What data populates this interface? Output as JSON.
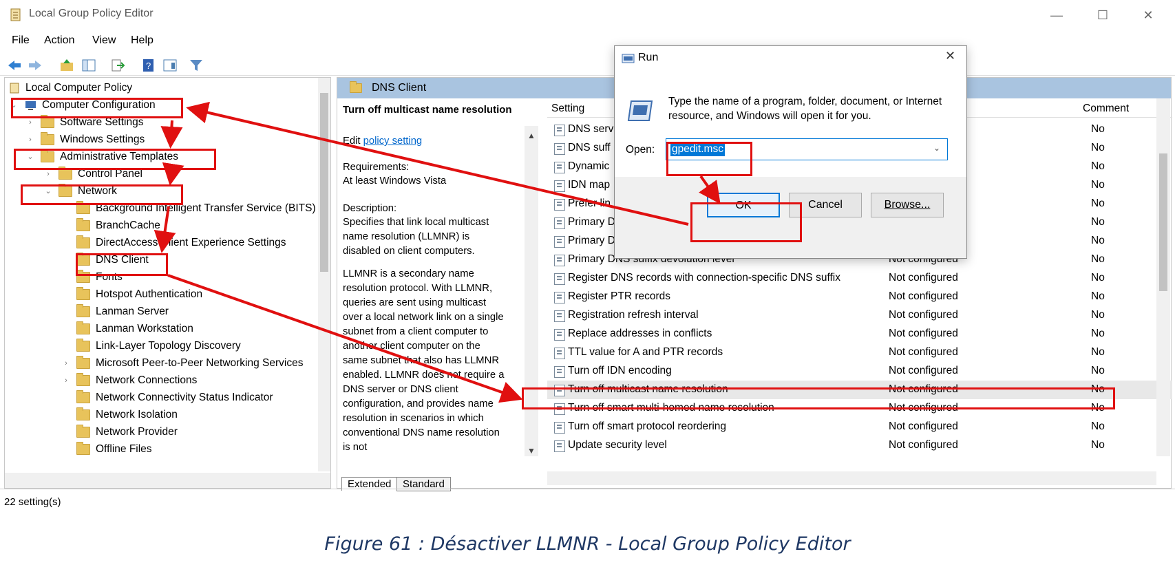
{
  "window": {
    "title": "Local Group Policy Editor",
    "controls": {
      "minimize": "—",
      "maximize": "☐",
      "close": "✕"
    }
  },
  "menu": [
    "File",
    "Action",
    "View",
    "Help"
  ],
  "tree": {
    "items": [
      {
        "label": "Local Computer Policy"
      },
      {
        "label": "Computer Configuration"
      },
      {
        "label": "Software Settings"
      },
      {
        "label": "Windows Settings"
      },
      {
        "label": "Administrative Templates"
      },
      {
        "label": "Control Panel"
      },
      {
        "label": "Network"
      },
      {
        "label": "Background Intelligent Transfer Service (BITS)"
      },
      {
        "label": "BranchCache"
      },
      {
        "label": "DirectAccess Client Experience Settings"
      },
      {
        "label": "DNS Client"
      },
      {
        "label": "Fonts"
      },
      {
        "label": "Hotspot Authentication"
      },
      {
        "label": "Lanman Server"
      },
      {
        "label": "Lanman Workstation"
      },
      {
        "label": "Link-Layer Topology Discovery"
      },
      {
        "label": "Microsoft Peer-to-Peer Networking Services"
      },
      {
        "label": "Network Connections"
      },
      {
        "label": "Network Connectivity Status Indicator"
      },
      {
        "label": "Network Isolation"
      },
      {
        "label": "Network Provider"
      },
      {
        "label": "Offline Files"
      }
    ]
  },
  "details": {
    "folder_title": "DNS Client",
    "policy_title": "Turn off multicast name resolution",
    "edit_link_prefix": "Edit",
    "edit_link": "policy setting",
    "requirements_label": "Requirements:",
    "requirements_value": "At least Windows Vista",
    "description_label": "Description:",
    "description_1": "Specifies that link local multicast name resolution (LLMNR) is disabled on client computers.",
    "description_2": "LLMNR is a secondary name resolution protocol. With LLMNR, queries are sent using multicast over a local network link on a single subnet from a client computer to another client computer on the same subnet that also has LLMNR enabled. LLMNR does not require a DNS server or DNS client configuration, and provides name resolution in scenarios in which conventional DNS name resolution is not",
    "tabs": [
      "Extended",
      "Standard"
    ]
  },
  "list": {
    "headers": {
      "setting": "Setting",
      "comment": "Comment"
    },
    "rows": [
      {
        "name": "DNS serv",
        "state": "",
        "comment": "No"
      },
      {
        "name": "DNS suff",
        "state": "",
        "comment": "No"
      },
      {
        "name": "Dynamic",
        "state": "",
        "comment": "No"
      },
      {
        "name": "IDN map",
        "state": "",
        "comment": "No"
      },
      {
        "name": "Prefer lin",
        "state": "",
        "comment": "No"
      },
      {
        "name": "Primary D",
        "state": "",
        "comment": "No"
      },
      {
        "name": "Primary D",
        "state": "",
        "comment": "No"
      },
      {
        "name": "Primary DNS suffix devolution level",
        "state": "Not configured",
        "comment": "No"
      },
      {
        "name": "Register DNS records with connection-specific DNS suffix",
        "state": "Not configured",
        "comment": "No"
      },
      {
        "name": "Register PTR records",
        "state": "Not configured",
        "comment": "No"
      },
      {
        "name": "Registration refresh interval",
        "state": "Not configured",
        "comment": "No"
      },
      {
        "name": "Replace addresses in conflicts",
        "state": "Not configured",
        "comment": "No"
      },
      {
        "name": "TTL value for A and PTR records",
        "state": "Not configured",
        "comment": "No"
      },
      {
        "name": "Turn off IDN encoding",
        "state": "Not configured",
        "comment": "No"
      },
      {
        "name": "Turn off multicast name resolution",
        "state": "Not configured",
        "comment": "No"
      },
      {
        "name": "Turn off smart multi-homed name resolution",
        "state": "Not configured",
        "comment": "No"
      },
      {
        "name": "Turn off smart protocol reordering",
        "state": "Not configured",
        "comment": "No"
      },
      {
        "name": "Update security level",
        "state": "Not configured",
        "comment": "No"
      }
    ]
  },
  "status": "22 setting(s)",
  "run_dialog": {
    "title": "Run",
    "close": "✕",
    "prompt": "Type the name of a program, folder, document, or Internet resource, and Windows will open it for you.",
    "open_label": "Open:",
    "open_value": "gpedit.msc",
    "ok": "OK",
    "cancel": "Cancel",
    "browse": "Browse..."
  },
  "caption": "Figure 61 : Désactiver LLMNR - Local Group Policy Editor",
  "colors": {
    "annotation": "#e01010",
    "selection": "#0078d7",
    "header_band": "#a9c4e0",
    "caption": "#1f3864"
  }
}
